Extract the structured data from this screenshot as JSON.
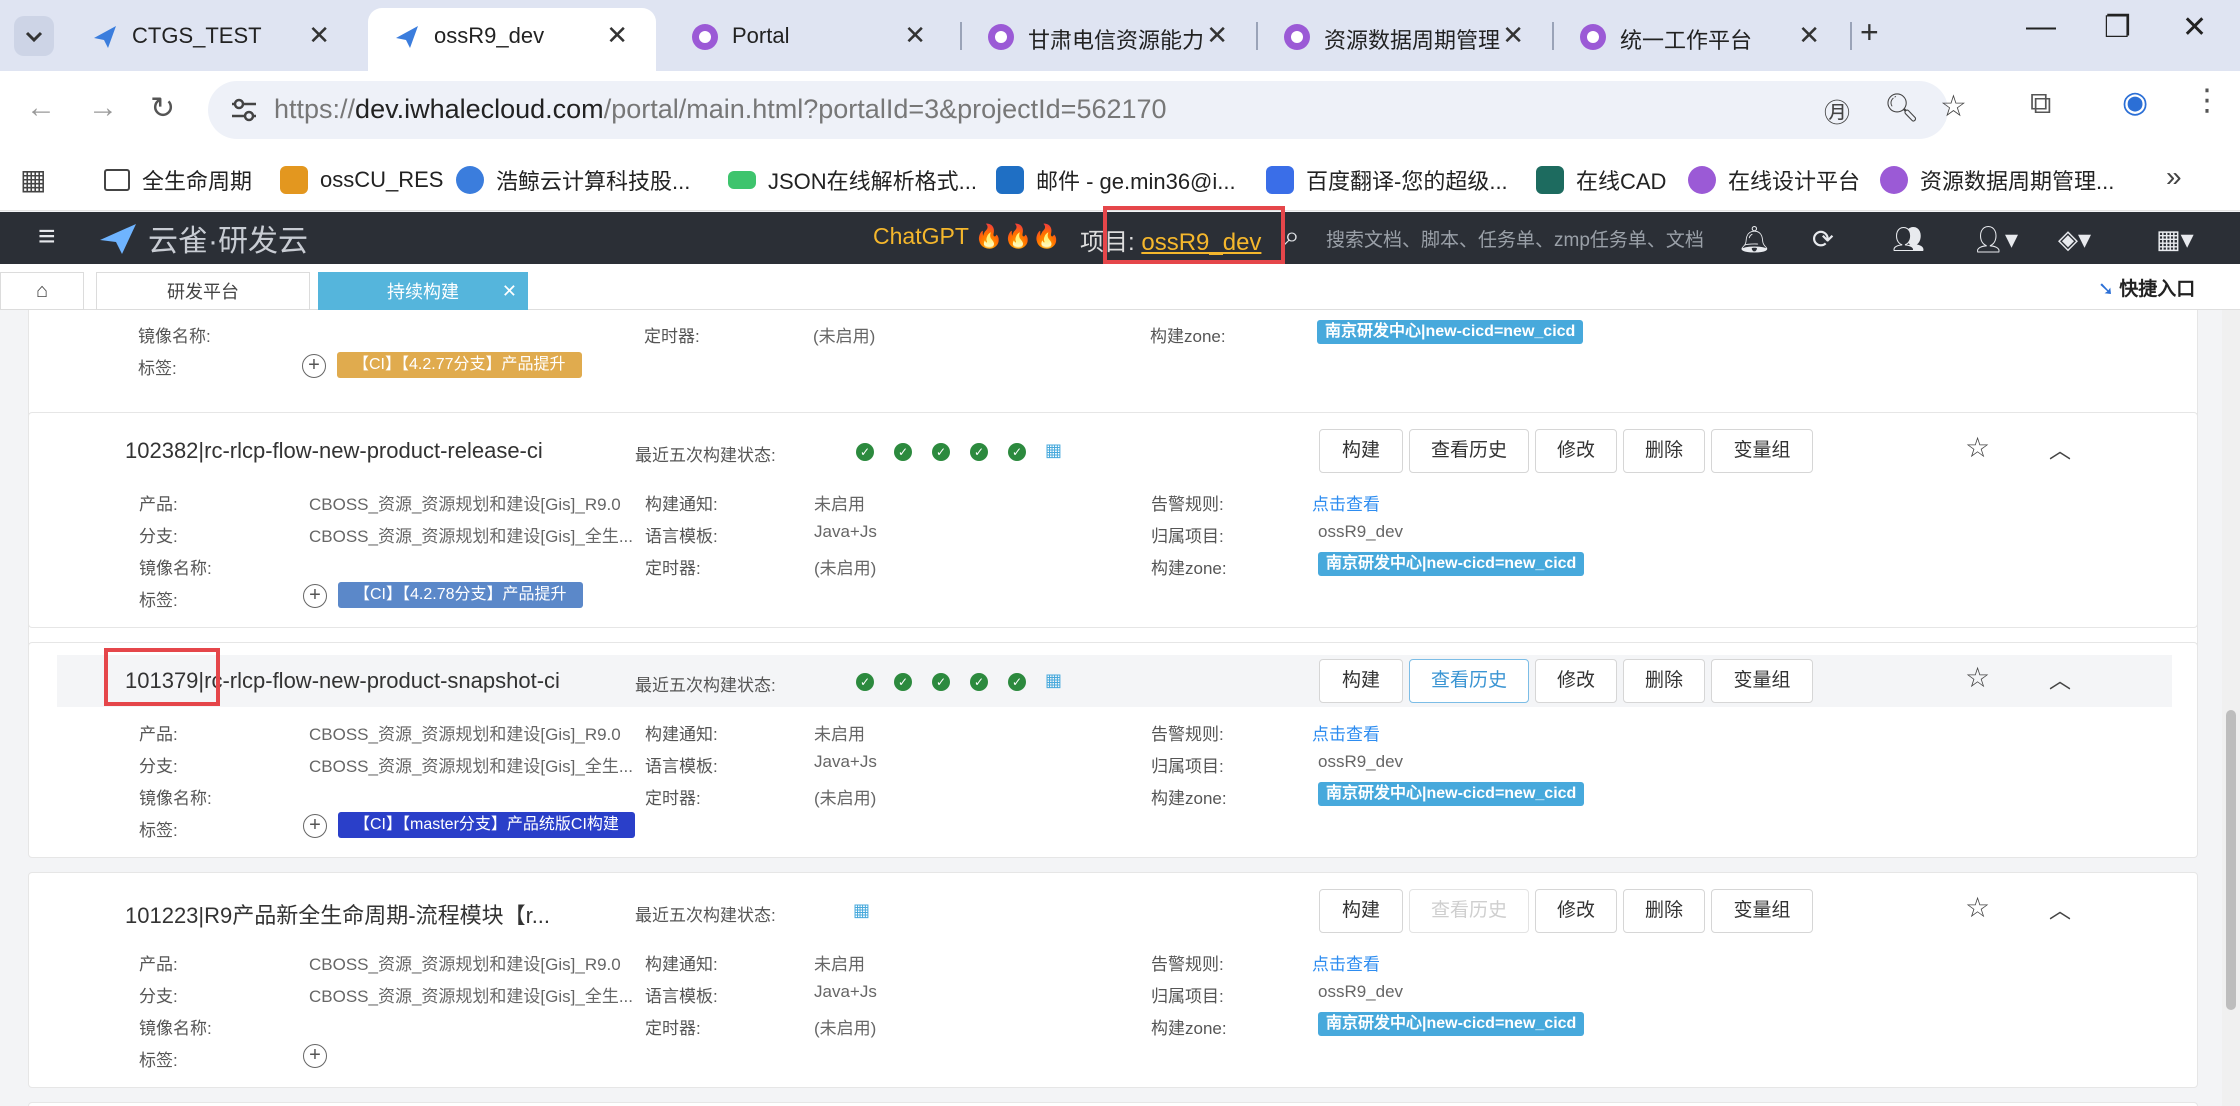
{
  "browser": {
    "tabs": [
      {
        "title": "CTGS_TEST",
        "active": false
      },
      {
        "title": "ossR9_dev",
        "active": true
      },
      {
        "title": "Portal",
        "active": false
      },
      {
        "title": "甘肃电信资源能力",
        "active": false
      },
      {
        "title": "资源数据周期管理",
        "active": false
      },
      {
        "title": "统一工作平台",
        "active": false
      }
    ],
    "url_prefix": "https://",
    "url_host": "dev.iwhalecloud.com",
    "url_path": "/portal/main.html?portalId=3&projectId=562170",
    "bookmarks": [
      {
        "label": "全生命周期",
        "icon": "folder-icon"
      },
      {
        "label": "ossCU_RES",
        "icon": "cube-icon"
      },
      {
        "label": "浩鲸云计算科技股...",
        "icon": "whale-icon"
      },
      {
        "label": "JSON在线解析格式...",
        "icon": "json-icon"
      },
      {
        "label": "邮件 - ge.min36@i...",
        "icon": "outlook-icon"
      },
      {
        "label": "百度翻译-您的超级...",
        "icon": "translate-icon"
      },
      {
        "label": "在线CAD",
        "icon": "cad-icon"
      },
      {
        "label": "在线设计平台",
        "icon": "portal-icon"
      },
      {
        "label": "资源数据周期管理...",
        "icon": "portal-icon"
      }
    ]
  },
  "app": {
    "logo_text": "云雀·研发云",
    "chatgpt_label": "ChatGPT",
    "project_prefix": "项目:",
    "project_name": "ossR9_dev",
    "search_placeholder": "搜索文档、脚本、任务单、zmp任务单、文档",
    "subtabs": [
      "研发平台",
      "持续构建"
    ],
    "quick_entry": "快捷入口"
  },
  "labels": {
    "product": "产品:",
    "branch": "分支:",
    "image": "镜像名称:",
    "tag": "标签:",
    "recent": "最近五次构建状态:",
    "notify": "构建通知:",
    "lang": "语言模板:",
    "timer": "定时器:",
    "alert": "告警规则:",
    "project": "归属项目:",
    "zone": "构建zone:"
  },
  "buttons": {
    "build": "构建",
    "history": "查看历史",
    "edit": "修改",
    "delete": "删除",
    "vars": "变量组"
  },
  "jobs": [
    {
      "title": "",
      "timer": "(未启用)",
      "zone": "南京研发中心|new-cicd=new_cicd",
      "tag": "【CI】【4.2.77分支】产品提升",
      "tag_color": "#e0ab4e"
    },
    {
      "title": "102382|rc-rlcp-flow-new-product-release-ci",
      "recent_success": 5,
      "product": "CBOSS_资源_资源规划和建设[Gis]_R9.0",
      "branch": "CBOSS_资源_资源规划和建设[Gis]_全生...",
      "notify": "未启用",
      "lang": "Java+Js",
      "timer": "(未启用)",
      "alert": "点击查看",
      "project": "ossR9_dev",
      "zone": "南京研发中心|new-cicd=new_cicd",
      "tag": "【CI】【4.2.78分支】产品提升",
      "tag_color": "#5b88c9"
    },
    {
      "title_id": "101379",
      "title": "|rc-rlcp-flow-new-product-snapshot-ci",
      "recent_success": 5,
      "product": "CBOSS_资源_资源规划和建设[Gis]_R9.0",
      "branch": "CBOSS_资源_资源规划和建设[Gis]_全生...",
      "notify": "未启用",
      "lang": "Java+Js",
      "timer": "(未启用)",
      "alert": "点击查看",
      "project": "ossR9_dev",
      "zone": "南京研发中心|new-cicd=new_cicd",
      "tag": "【CI】【master分支】产品统版CI构建",
      "tag_color": "#2a3fc9"
    },
    {
      "title": "101223|R9产品新全生命周期-流程模块【r...",
      "recent_success": 0,
      "product": "CBOSS_资源_资源规划和建设[Gis]_R9.0",
      "branch": "CBOSS_资源_资源规划和建设[Gis]_全生...",
      "notify": "未启用",
      "lang": "Java+Js",
      "timer": "(未启用)",
      "alert": "点击查看",
      "project": "ossR9_dev",
      "zone": "南京研发中心|new-cicd=new_cicd",
      "tag": ""
    }
  ]
}
